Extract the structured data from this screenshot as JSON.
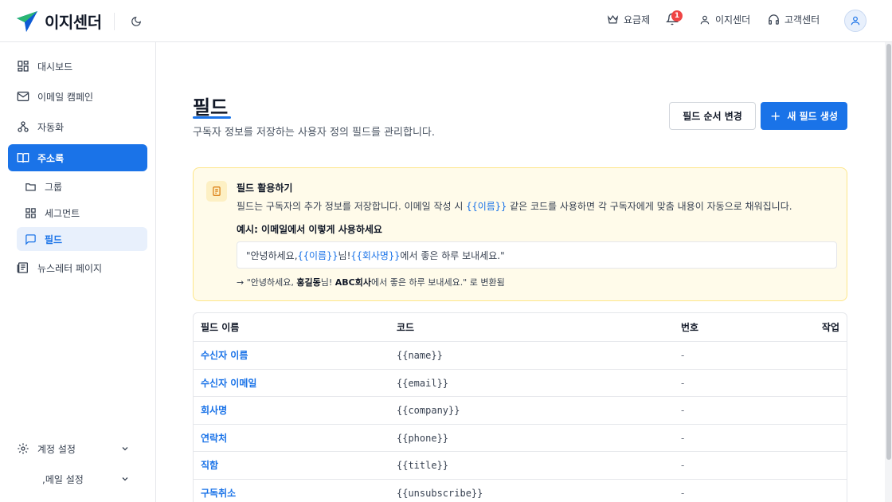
{
  "header": {
    "brand": "이지센더",
    "nav_plan": "요금제",
    "notification_count": "1",
    "nav_account": "이지센더",
    "nav_support": "고객센터"
  },
  "sidebar": {
    "items": [
      {
        "label": "대시보드",
        "icon": "dashboard-grid-icon"
      },
      {
        "label": "이메일 캠페인",
        "icon": "mail-icon"
      },
      {
        "label": "자동화",
        "icon": "workflow-icon"
      },
      {
        "label": "주소록",
        "icon": "book-open-icon"
      },
      {
        "label": "그룹",
        "icon": "folder-icon"
      },
      {
        "label": "세그먼트",
        "icon": "grid-icon"
      },
      {
        "label": "필드",
        "icon": "message-square-icon"
      },
      {
        "label": "뉴스레터 페이지",
        "icon": "newspaper-icon"
      }
    ],
    "account_settings": "계정 설정",
    "email_settings": ",메일 설정"
  },
  "page": {
    "title": "필드",
    "subtitle": "구독자 정보를 저장하는 사용자 정의 필드를 관리합니다.",
    "reorder_button": "필드 순서 변경",
    "new_button": "새 필드 생성"
  },
  "info": {
    "title": "필드 활용하기",
    "desc_before": "필드는 구독자의 추가 정보를 저장합니다. 이메일 작성 시 ",
    "desc_code": "{{이름}}",
    "desc_after": " 같은 코드를 사용하면 각 구독자에게 맞춤 내용이 자동으로 채워집니다.",
    "example_label": "예시: 이메일에서 이렇게 사용하세요",
    "example_part1": "\"안녕하세요, ",
    "example_code1": "{{이름}}",
    "example_part2": "님! ",
    "example_code2": "{{회사명}}",
    "example_part3": "에서 좋은 하루 보내세요.\"",
    "result_prefix": "→ \"안녕하세요, ",
    "result_name": "홍길동",
    "result_mid1": "님! ",
    "result_company": "ABC회사",
    "result_suffix": "에서 좋은 하루 보내세요.\" 로 변환됨"
  },
  "table": {
    "headers": {
      "name": "필드 이름",
      "code": "코드",
      "number": "번호",
      "action": "작업"
    },
    "rows": [
      {
        "name": "수신자 이름",
        "code": "{{name}}",
        "number": "-"
      },
      {
        "name": "수신자 이메일",
        "code": "{{email}}",
        "number": "-"
      },
      {
        "name": "회사명",
        "code": "{{company}}",
        "number": "-"
      },
      {
        "name": "연락처",
        "code": "{{phone}}",
        "number": "-"
      },
      {
        "name": "직함",
        "code": "{{title}}",
        "number": "-"
      },
      {
        "name": "구독취소",
        "code": "{{unsubscribe}}",
        "number": "-"
      }
    ]
  },
  "colors": {
    "accent": "#1a73e8",
    "info_bg": "#fffbea",
    "info_border": "#fde68a",
    "badge": "#ef4444"
  }
}
